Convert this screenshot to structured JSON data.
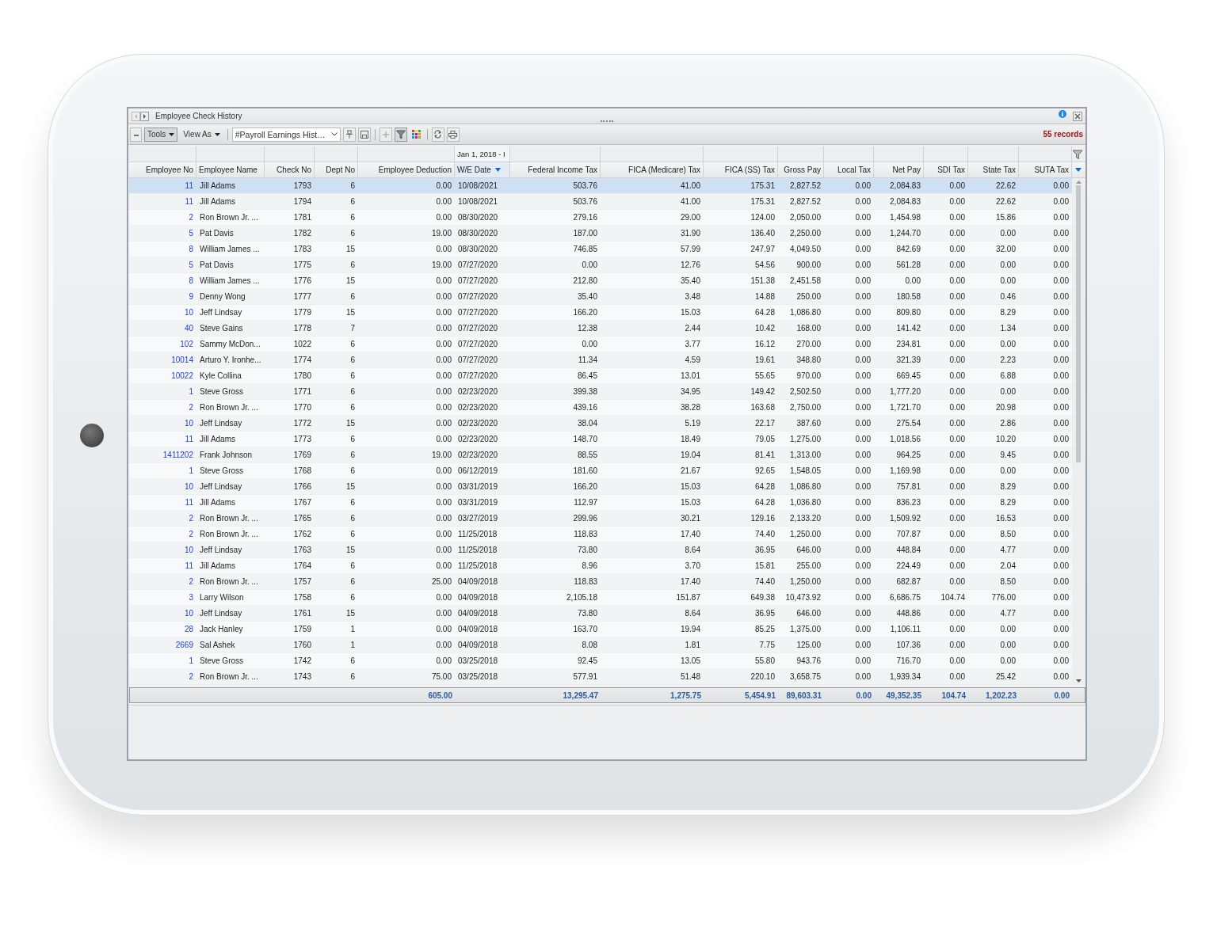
{
  "window": {
    "title": "Employee Check History"
  },
  "toolbar": {
    "tools": "Tools",
    "view_as": "View As",
    "layout": "#Payroll Earnings Hist…",
    "filter_on": true,
    "record_count": "55 records"
  },
  "table": {
    "columns": [
      {
        "label": "Employee No",
        "kind": "link",
        "sorted": false,
        "totaled": false
      },
      {
        "label": "Employee Name",
        "kind": "text",
        "sorted": false,
        "totaled": false
      },
      {
        "label": "Check No",
        "kind": "number",
        "sorted": false,
        "totaled": false
      },
      {
        "label": "Dept No",
        "kind": "number",
        "sorted": false,
        "totaled": false
      },
      {
        "label": "Employee Deduction",
        "kind": "number",
        "sorted": false,
        "totaled": true
      },
      {
        "label": "W/E Date",
        "kind": "text",
        "sorted": true,
        "totaled": false,
        "group": "Jan 1, 2018 - I"
      },
      {
        "label": "Federal Income Tax",
        "kind": "number",
        "sorted": false,
        "totaled": true
      },
      {
        "label": "FICA (Medicare) Tax",
        "kind": "number",
        "sorted": false,
        "totaled": true
      },
      {
        "label": "FICA (SS) Tax",
        "kind": "number",
        "sorted": false,
        "totaled": true
      },
      {
        "label": "Gross Pay",
        "kind": "number",
        "sorted": false,
        "totaled": true
      },
      {
        "label": "Local Tax",
        "kind": "number",
        "sorted": false,
        "totaled": true
      },
      {
        "label": "Net Pay",
        "kind": "number",
        "sorted": false,
        "totaled": true
      },
      {
        "label": "SDI Tax",
        "kind": "number",
        "sorted": false,
        "totaled": true
      },
      {
        "label": "State Tax",
        "kind": "number",
        "sorted": false,
        "totaled": true
      },
      {
        "label": "SUTA Tax",
        "kind": "number",
        "sorted": false,
        "totaled": true
      }
    ],
    "rows": [
      {
        "selected": true,
        "cells": [
          "11",
          "Jill Adams",
          "1793",
          "6",
          "0.00",
          "10/08/2021",
          "503.76",
          "41.00",
          "175.31",
          "2,827.52",
          "0.00",
          "2,084.83",
          "0.00",
          "22.62",
          "0.00"
        ]
      },
      {
        "selected": false,
        "cells": [
          "11",
          "Jill Adams",
          "1794",
          "6",
          "0.00",
          "10/08/2021",
          "503.76",
          "41.00",
          "175.31",
          "2,827.52",
          "0.00",
          "2,084.83",
          "0.00",
          "22.62",
          "0.00"
        ]
      },
      {
        "selected": false,
        "cells": [
          "2",
          "Ron Brown Jr. ...",
          "1781",
          "6",
          "0.00",
          "08/30/2020",
          "279.16",
          "29.00",
          "124.00",
          "2,050.00",
          "0.00",
          "1,454.98",
          "0.00",
          "15.86",
          "0.00"
        ]
      },
      {
        "selected": false,
        "cells": [
          "5",
          "Pat Davis",
          "1782",
          "6",
          "19.00",
          "08/30/2020",
          "187.00",
          "31.90",
          "136.40",
          "2,250.00",
          "0.00",
          "1,244.70",
          "0.00",
          "0.00",
          "0.00"
        ]
      },
      {
        "selected": false,
        "cells": [
          "8",
          "William James ...",
          "1783",
          "15",
          "0.00",
          "08/30/2020",
          "746.85",
          "57.99",
          "247.97",
          "4,049.50",
          "0.00",
          "842.69",
          "0.00",
          "32.00",
          "0.00"
        ]
      },
      {
        "selected": false,
        "cells": [
          "5",
          "Pat Davis",
          "1775",
          "6",
          "19.00",
          "07/27/2020",
          "0.00",
          "12.76",
          "54.56",
          "900.00",
          "0.00",
          "561.28",
          "0.00",
          "0.00",
          "0.00"
        ]
      },
      {
        "selected": false,
        "cells": [
          "8",
          "William James ...",
          "1776",
          "15",
          "0.00",
          "07/27/2020",
          "212.80",
          "35.40",
          "151.38",
          "2,451.58",
          "0.00",
          "0.00",
          "0.00",
          "0.00",
          "0.00"
        ]
      },
      {
        "selected": false,
        "cells": [
          "9",
          "Denny Wong",
          "1777",
          "6",
          "0.00",
          "07/27/2020",
          "35.40",
          "3.48",
          "14.88",
          "250.00",
          "0.00",
          "180.58",
          "0.00",
          "0.46",
          "0.00"
        ]
      },
      {
        "selected": false,
        "cells": [
          "10",
          "Jeff Lindsay",
          "1779",
          "15",
          "0.00",
          "07/27/2020",
          "166.20",
          "15.03",
          "64.28",
          "1,086.80",
          "0.00",
          "809.80",
          "0.00",
          "8.29",
          "0.00"
        ]
      },
      {
        "selected": false,
        "cells": [
          "40",
          "Steve Gains",
          "1778",
          "7",
          "0.00",
          "07/27/2020",
          "12.38",
          "2.44",
          "10.42",
          "168.00",
          "0.00",
          "141.42",
          "0.00",
          "1.34",
          "0.00"
        ]
      },
      {
        "selected": false,
        "cells": [
          "102",
          "Sammy McDon...",
          "1022",
          "6",
          "0.00",
          "07/27/2020",
          "0.00",
          "3.77",
          "16.12",
          "270.00",
          "0.00",
          "234.81",
          "0.00",
          "0.00",
          "0.00"
        ]
      },
      {
        "selected": false,
        "cells": [
          "10014",
          "Arturo Y. Ironhe...",
          "1774",
          "6",
          "0.00",
          "07/27/2020",
          "11.34",
          "4.59",
          "19.61",
          "348.80",
          "0.00",
          "321.39",
          "0.00",
          "2.23",
          "0.00"
        ]
      },
      {
        "selected": false,
        "cells": [
          "10022",
          "Kyle Collina",
          "1780",
          "6",
          "0.00",
          "07/27/2020",
          "86.45",
          "13.01",
          "55.65",
          "970.00",
          "0.00",
          "669.45",
          "0.00",
          "6.88",
          "0.00"
        ]
      },
      {
        "selected": false,
        "cells": [
          "1",
          "Steve Gross",
          "1771",
          "6",
          "0.00",
          "02/23/2020",
          "399.38",
          "34.95",
          "149.42",
          "2,502.50",
          "0.00",
          "1,777.20",
          "0.00",
          "0.00",
          "0.00"
        ]
      },
      {
        "selected": false,
        "cells": [
          "2",
          "Ron Brown Jr. ...",
          "1770",
          "6",
          "0.00",
          "02/23/2020",
          "439.16",
          "38.28",
          "163.68",
          "2,750.00",
          "0.00",
          "1,721.70",
          "0.00",
          "20.98",
          "0.00"
        ]
      },
      {
        "selected": false,
        "cells": [
          "10",
          "Jeff Lindsay",
          "1772",
          "15",
          "0.00",
          "02/23/2020",
          "38.04",
          "5.19",
          "22.17",
          "387.60",
          "0.00",
          "275.54",
          "0.00",
          "2.86",
          "0.00"
        ]
      },
      {
        "selected": false,
        "cells": [
          "11",
          "Jill Adams",
          "1773",
          "6",
          "0.00",
          "02/23/2020",
          "148.70",
          "18.49",
          "79.05",
          "1,275.00",
          "0.00",
          "1,018.56",
          "0.00",
          "10.20",
          "0.00"
        ]
      },
      {
        "selected": false,
        "cells": [
          "1411202",
          "Frank Johnson",
          "1769",
          "6",
          "19.00",
          "02/23/2020",
          "88.55",
          "19.04",
          "81.41",
          "1,313.00",
          "0.00",
          "964.25",
          "0.00",
          "9.45",
          "0.00"
        ]
      },
      {
        "selected": false,
        "cells": [
          "1",
          "Steve Gross",
          "1768",
          "6",
          "0.00",
          "06/12/2019",
          "181.60",
          "21.67",
          "92.65",
          "1,548.05",
          "0.00",
          "1,169.98",
          "0.00",
          "0.00",
          "0.00"
        ]
      },
      {
        "selected": false,
        "cells": [
          "10",
          "Jeff Lindsay",
          "1766",
          "15",
          "0.00",
          "03/31/2019",
          "166.20",
          "15.03",
          "64.28",
          "1,086.80",
          "0.00",
          "757.81",
          "0.00",
          "8.29",
          "0.00"
        ]
      },
      {
        "selected": false,
        "cells": [
          "11",
          "Jill Adams",
          "1767",
          "6",
          "0.00",
          "03/31/2019",
          "112.97",
          "15.03",
          "64.28",
          "1,036.80",
          "0.00",
          "836.23",
          "0.00",
          "8.29",
          "0.00"
        ]
      },
      {
        "selected": false,
        "cells": [
          "2",
          "Ron Brown Jr. ...",
          "1765",
          "6",
          "0.00",
          "03/27/2019",
          "299.96",
          "30.21",
          "129.16",
          "2,133.20",
          "0.00",
          "1,509.92",
          "0.00",
          "16.53",
          "0.00"
        ]
      },
      {
        "selected": false,
        "cells": [
          "2",
          "Ron Brown Jr. ...",
          "1762",
          "6",
          "0.00",
          "11/25/2018",
          "118.83",
          "17.40",
          "74.40",
          "1,250.00",
          "0.00",
          "707.87",
          "0.00",
          "8.50",
          "0.00"
        ]
      },
      {
        "selected": false,
        "cells": [
          "10",
          "Jeff Lindsay",
          "1763",
          "15",
          "0.00",
          "11/25/2018",
          "73.80",
          "8.64",
          "36.95",
          "646.00",
          "0.00",
          "448.84",
          "0.00",
          "4.77",
          "0.00"
        ]
      },
      {
        "selected": false,
        "cells": [
          "11",
          "Jill Adams",
          "1764",
          "6",
          "0.00",
          "11/25/2018",
          "8.96",
          "3.70",
          "15.81",
          "255.00",
          "0.00",
          "224.49",
          "0.00",
          "2.04",
          "0.00"
        ]
      },
      {
        "selected": false,
        "cells": [
          "2",
          "Ron Brown Jr. ...",
          "1757",
          "6",
          "25.00",
          "04/09/2018",
          "118.83",
          "17.40",
          "74.40",
          "1,250.00",
          "0.00",
          "682.87",
          "0.00",
          "8.50",
          "0.00"
        ]
      },
      {
        "selected": false,
        "cells": [
          "3",
          "Larry Wilson",
          "1758",
          "6",
          "0.00",
          "04/09/2018",
          "2,105.18",
          "151.87",
          "649.38",
          "10,473.92",
          "0.00",
          "6,686.75",
          "104.74",
          "776.00",
          "0.00"
        ]
      },
      {
        "selected": false,
        "cells": [
          "10",
          "Jeff Lindsay",
          "1761",
          "15",
          "0.00",
          "04/09/2018",
          "73.80",
          "8.64",
          "36.95",
          "646.00",
          "0.00",
          "448.86",
          "0.00",
          "4.77",
          "0.00"
        ]
      },
      {
        "selected": false,
        "cells": [
          "28",
          "Jack Hanley",
          "1759",
          "1",
          "0.00",
          "04/09/2018",
          "163.70",
          "19.94",
          "85.25",
          "1,375.00",
          "0.00",
          "1,106.11",
          "0.00",
          "0.00",
          "0.00"
        ]
      },
      {
        "selected": false,
        "cells": [
          "2669",
          "Sal Ashek",
          "1760",
          "1",
          "0.00",
          "04/09/2018",
          "8.08",
          "1.81",
          "7.75",
          "125.00",
          "0.00",
          "107.36",
          "0.00",
          "0.00",
          "0.00"
        ]
      },
      {
        "selected": false,
        "cells": [
          "1",
          "Steve Gross",
          "1742",
          "6",
          "0.00",
          "03/25/2018",
          "92.45",
          "13.05",
          "55.80",
          "943.76",
          "0.00",
          "716.70",
          "0.00",
          "0.00",
          "0.00"
        ]
      },
      {
        "selected": false,
        "cells": [
          "2",
          "Ron Brown Jr. ...",
          "1743",
          "6",
          "75.00",
          "03/25/2018",
          "577.91",
          "51.48",
          "220.10",
          "3,658.75",
          "0.00",
          "1,939.34",
          "0.00",
          "25.42",
          "0.00"
        ]
      }
    ],
    "totals": [
      "605.00",
      "13,295.47",
      "1,275.75",
      "5,454.91",
      "89,603.31",
      "0.00",
      "49,352.35",
      "104.74",
      "1,202.23",
      "0.00"
    ]
  }
}
